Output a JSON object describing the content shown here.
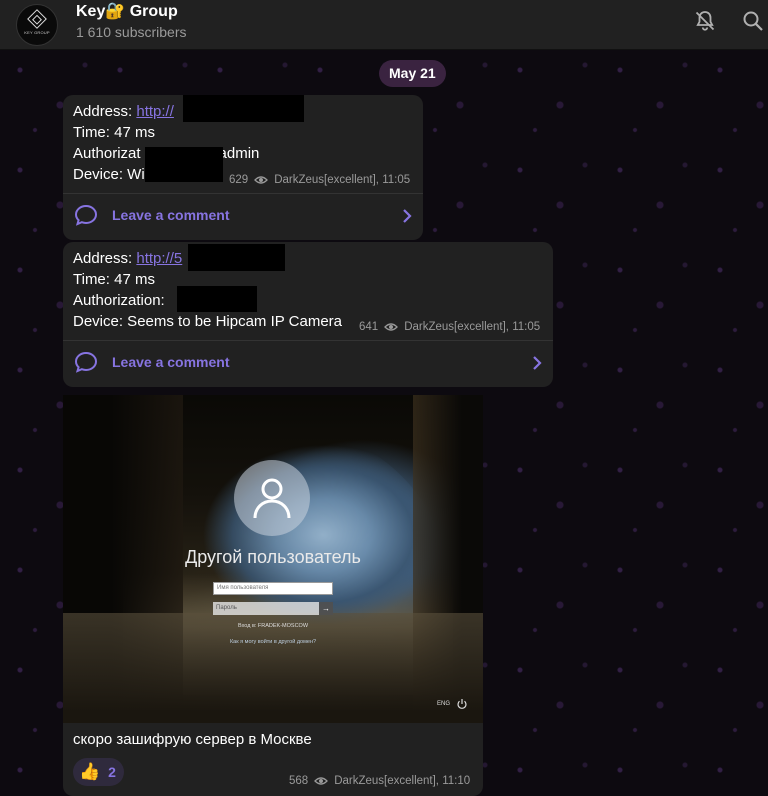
{
  "header": {
    "title": "Key🔐 Group",
    "subscribers": "1 610 subscribers",
    "avatar_text": "KEY GROUP",
    "icons": [
      "bell-muted-icon",
      "search-icon"
    ]
  },
  "date_separator": "May 21",
  "messages": [
    {
      "lines": [
        {
          "label": "Address: ",
          "link": "http://"
        },
        {
          "label": "Time: 47 ms"
        },
        {
          "label": "Authorizat",
          "suffix": "admin"
        },
        {
          "label": "Device: Wi"
        }
      ],
      "views": "629",
      "author_time": "DarkZeus[excellent], 11:05",
      "comment_label": "Leave a comment"
    },
    {
      "lines": [
        {
          "label": "Address: ",
          "link": "http://5"
        },
        {
          "label": "Time: 47 ms"
        },
        {
          "label": "Authorization: "
        },
        {
          "label": "Device: Seems to be Hipcam IP Camera"
        }
      ],
      "views": "641",
      "author_time": "DarkZeus[excellent], 11:05",
      "comment_label": "Leave a comment"
    }
  ],
  "photo_message": {
    "screen": {
      "user_name": "Другой пользователь",
      "username_placeholder": "Имя пользователя",
      "password_placeholder": "Пароль",
      "domain_text": "Вход в: FRADEK-MOSCOW",
      "domain_link": "Как я могу войти в другой домен?",
      "lang": "ENG"
    },
    "caption": "скоро зашифрую сервер в Москве",
    "reaction": {
      "emoji": "👍",
      "count": "2"
    },
    "views": "568",
    "author_time": "DarkZeus[excellent], 11:10"
  },
  "colors": {
    "accent": "#8774e1",
    "bubble": "#212121",
    "header": "#212121",
    "date_pill": "#3a2340"
  }
}
